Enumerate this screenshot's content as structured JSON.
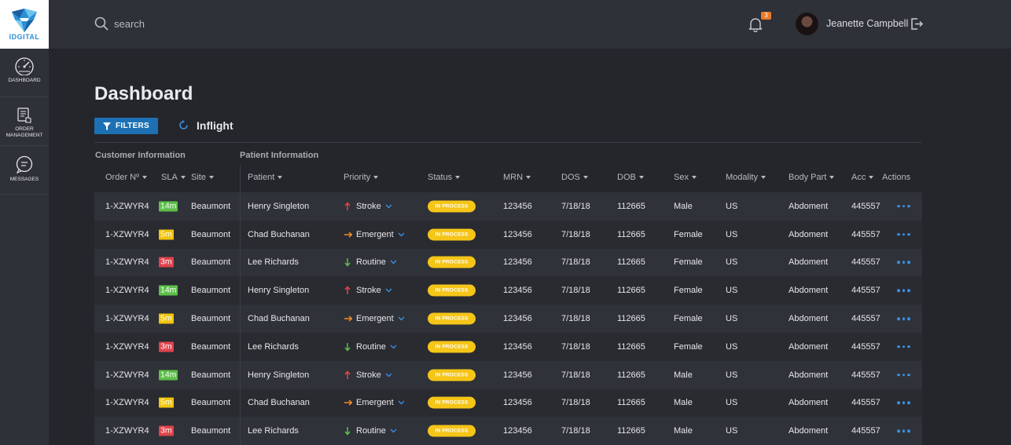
{
  "brand": {
    "logo_text": "IDGITAL"
  },
  "sidebar": {
    "items": [
      {
        "label": "DASHBOARD"
      },
      {
        "label": "ORDER MANAGEMENT"
      },
      {
        "label": "MESSAGES"
      }
    ]
  },
  "header": {
    "search_placeholder": "search",
    "notification_count": "3",
    "user_name": "Jeanette Campbell"
  },
  "page": {
    "title": "Dashboard",
    "filters_label": "FILTERS",
    "view_label": "Inflight"
  },
  "table": {
    "groups": [
      "Customer Information",
      "Patient Information"
    ],
    "columns": [
      "Order Nº",
      "SLA",
      "Site",
      "Patient",
      "Priority",
      "Status",
      "MRN",
      "DOS",
      "DOB",
      "Sex",
      "Modality",
      "Body Part",
      "Acc",
      "Actions"
    ],
    "rows": [
      {
        "order": "1-XZWYR4",
        "sla": "14m",
        "site": "Beaumont",
        "patient": "Henry Singleton",
        "priority": "Stroke",
        "status": "IN PROCESS",
        "mrn": "123456",
        "dos": "7/18/18",
        "dob": "112665",
        "sex": "Male",
        "modality": "US",
        "body_part": "Abdoment",
        "acc": "445557"
      },
      {
        "order": "1-XZWYR4",
        "sla": "5m",
        "site": "Beaumont",
        "patient": "Chad Buchanan",
        "priority": "Emergent",
        "status": "IN PROCESS",
        "mrn": "123456",
        "dos": "7/18/18",
        "dob": "112665",
        "sex": "Female",
        "modality": "US",
        "body_part": "Abdoment",
        "acc": "445557"
      },
      {
        "order": "1-XZWYR4",
        "sla": "3m",
        "site": "Beaumont",
        "patient": "Lee Richards",
        "priority": "Routine",
        "status": "IN PROCESS",
        "mrn": "123456",
        "dos": "7/18/18",
        "dob": "112665",
        "sex": "Female",
        "modality": "US",
        "body_part": "Abdoment",
        "acc": "445557"
      },
      {
        "order": "1-XZWYR4",
        "sla": "14m",
        "site": "Beaumont",
        "patient": "Henry Singleton",
        "priority": "Stroke",
        "status": "IN PROCESS",
        "mrn": "123456",
        "dos": "7/18/18",
        "dob": "112665",
        "sex": "Female",
        "modality": "US",
        "body_part": "Abdoment",
        "acc": "445557"
      },
      {
        "order": "1-XZWYR4",
        "sla": "5m",
        "site": "Beaumont",
        "patient": "Chad Buchanan",
        "priority": "Emergent",
        "status": "IN PROCESS",
        "mrn": "123456",
        "dos": "7/18/18",
        "dob": "112665",
        "sex": "Female",
        "modality": "US",
        "body_part": "Abdoment",
        "acc": "445557"
      },
      {
        "order": "1-XZWYR4",
        "sla": "3m",
        "site": "Beaumont",
        "patient": "Lee Richards",
        "priority": "Routine",
        "status": "IN PROCESS",
        "mrn": "123456",
        "dos": "7/18/18",
        "dob": "112665",
        "sex": "Female",
        "modality": "US",
        "body_part": "Abdoment",
        "acc": "445557"
      },
      {
        "order": "1-XZWYR4",
        "sla": "14m",
        "site": "Beaumont",
        "patient": "Henry Singleton",
        "priority": "Stroke",
        "status": "IN PROCESS",
        "mrn": "123456",
        "dos": "7/18/18",
        "dob": "112665",
        "sex": "Male",
        "modality": "US",
        "body_part": "Abdoment",
        "acc": "445557"
      },
      {
        "order": "1-XZWYR4",
        "sla": "5m",
        "site": "Beaumont",
        "patient": "Chad Buchanan",
        "priority": "Emergent",
        "status": "IN PROCESS",
        "mrn": "123456",
        "dos": "7/18/18",
        "dob": "112665",
        "sex": "Male",
        "modality": "US",
        "body_part": "Abdoment",
        "acc": "445557"
      },
      {
        "order": "1-XZWYR4",
        "sla": "3m",
        "site": "Beaumont",
        "patient": "Lee Richards",
        "priority": "Routine",
        "status": "IN PROCESS",
        "mrn": "123456",
        "dos": "7/18/18",
        "dob": "112665",
        "sex": "Male",
        "modality": "US",
        "body_part": "Abdoment",
        "acc": "445557"
      }
    ]
  },
  "colors": {
    "sla_14m": "#5cbf4a",
    "sla_5m": "#f1c40f",
    "sla_3m": "#e0434b",
    "stroke_arrow": "#e8434b",
    "emergent_arrow": "#f08a2a",
    "routine_arrow": "#5cbf4a",
    "status_fill": "#f5c518",
    "accent_blue": "#1d70b3"
  },
  "icons": {
    "priority_stroke": "arrow-up-icon",
    "priority_emergent": "arrow-right-icon",
    "priority_routine": "arrow-down-icon"
  }
}
